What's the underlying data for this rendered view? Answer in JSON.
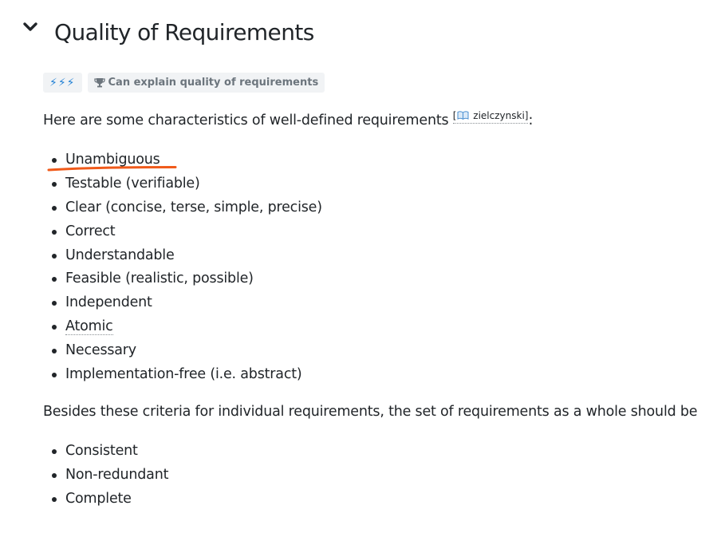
{
  "section": {
    "title": "Quality of Requirements",
    "toggle_icon": "chevron-down-icon"
  },
  "badges": {
    "difficulty_icons": "⚡⚡⚡",
    "outcome_icon": "trophy-icon",
    "outcome_label": "Can explain quality of requirements"
  },
  "intro": {
    "text": "Here are some characteristics of well-defined requirements ",
    "citation_open": "[",
    "citation_icon": "book-icon",
    "citation_label": " zielczynski",
    "citation_close": "]",
    "suffix": ":"
  },
  "characteristics": [
    "Unambiguous",
    "Testable (verifiable)",
    "Clear (concise, terse, simple, precise)",
    "Correct",
    "Understandable",
    "Feasible (realistic, possible)",
    "Independent",
    "Atomic",
    "Necessary",
    "Implementation-free (i.e. abstract)"
  ],
  "besides_text": "Besides these criteria for individual requirements, the set of requirements as a whole should be",
  "set_criteria": [
    "Consistent",
    "Non-redundant",
    "Complete"
  ],
  "colors": {
    "annotation": "#f05a1a",
    "bolt": "#1f7fd4",
    "badge_bg": "#f1f3f5"
  }
}
